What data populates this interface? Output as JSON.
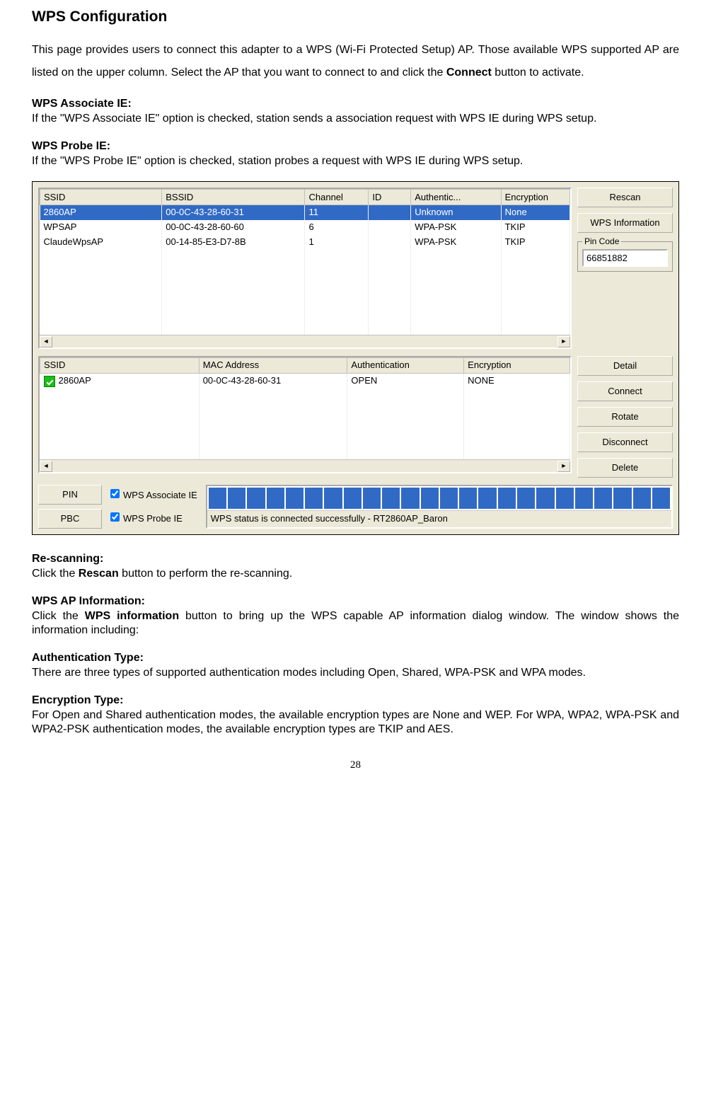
{
  "title": "WPS Configuration",
  "intro_pre": "This page provides users to connect this adapter to a WPS (Wi-Fi Protected Setup) AP. Those available WPS supported AP are listed on the upper column. Select the AP that you want to connect to and click the ",
  "intro_bold": "Connect",
  "intro_post": " button to activate.",
  "sec1_h": "WPS Associate IE:",
  "sec1_t": "If the \"WPS Associate IE\" option is checked, station sends a association request with WPS IE during WPS setup.",
  "sec2_h": "WPS Probe IE:",
  "sec2_t": "If the \"WPS Probe IE\" option is checked, station probes a request with WPS IE during WPS setup.",
  "table1": {
    "headers": [
      "SSID",
      "BSSID",
      "Channel",
      "ID",
      "Authentic...",
      "Encryption"
    ],
    "rows": [
      {
        "ssid": "2860AP",
        "bssid": "00-0C-43-28-60-31",
        "channel": "11",
        "id": "",
        "auth": "Unknown",
        "enc": "None",
        "selected": true
      },
      {
        "ssid": "WPSAP",
        "bssid": "00-0C-43-28-60-60",
        "channel": "6",
        "id": "",
        "auth": "WPA-PSK",
        "enc": "TKIP",
        "selected": false
      },
      {
        "ssid": "ClaudeWpsAP",
        "bssid": "00-14-85-E3-D7-8B",
        "channel": "1",
        "id": "",
        "auth": "WPA-PSK",
        "enc": "TKIP",
        "selected": false
      }
    ]
  },
  "side1": {
    "rescan": "Rescan",
    "wpsinfo": "WPS Information",
    "pin_label": "Pin Code",
    "pin_value": "66851882"
  },
  "table2": {
    "headers": [
      "SSID",
      "MAC Address",
      "Authentication",
      "Encryption"
    ],
    "rows": [
      {
        "ssid": "2860AP",
        "mac": "00-0C-43-28-60-31",
        "auth": "OPEN",
        "enc": "NONE",
        "checked": true
      }
    ]
  },
  "side2": {
    "detail": "Detail",
    "connect": "Connect",
    "rotate": "Rotate",
    "disconnect": "Disconnect",
    "delete": "Delete"
  },
  "bottom": {
    "pin": "PIN",
    "pbc": "PBC",
    "assoc": "WPS Associate IE",
    "probe": "WPS Probe IE",
    "status": "WPS status is connected successfully - RT2860AP_Baron"
  },
  "sec3_h": "Re-scanning:",
  "sec3_pre": "Click the ",
  "sec3_b": "Rescan",
  "sec3_post": " button to perform the re-scanning.",
  "sec4_h": "WPS AP Information:",
  "sec4_pre": "Click the ",
  "sec4_b": "WPS information",
  "sec4_post": " button to bring up the WPS capable AP information dialog window. The window shows the information including:",
  "sec5_h": "Authentication Type:",
  "sec5_t": "There are three types of supported authentication modes including Open, Shared, WPA-PSK and WPA modes.",
  "sec6_h": "Encryption Type:",
  "sec6_t": "For Open and Shared authentication modes, the available encryption types are None and WEP. For WPA, WPA2, WPA-PSK and WPA2-PSK authentication modes, the available encryption types are TKIP and AES.",
  "page": "28"
}
